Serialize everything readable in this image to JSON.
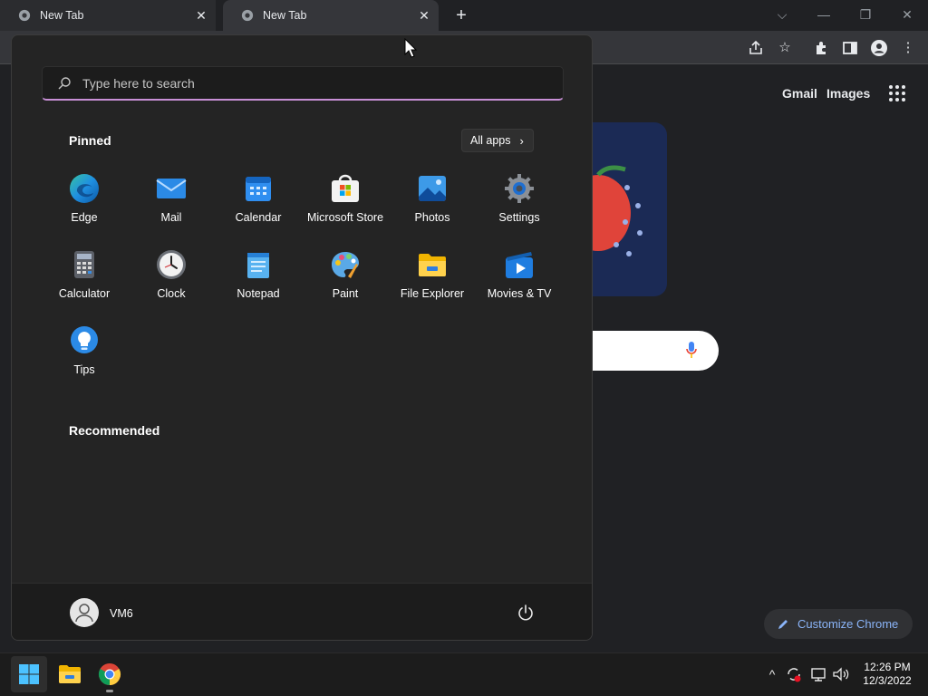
{
  "browser": {
    "tabs": [
      {
        "title": "New Tab",
        "active": false
      },
      {
        "title": "New Tab",
        "active": true
      }
    ],
    "ntp_links": {
      "gmail": "Gmail",
      "images": "Images"
    },
    "customize_label": "Customize Chrome"
  },
  "start_menu": {
    "search_placeholder": "Type here to search",
    "pinned_title": "Pinned",
    "all_apps_label": "All apps",
    "pinned_apps": [
      {
        "label": "Edge",
        "icon": "edge-icon"
      },
      {
        "label": "Mail",
        "icon": "mail-icon"
      },
      {
        "label": "Calendar",
        "icon": "calendar-icon"
      },
      {
        "label": "Microsoft Store",
        "icon": "store-icon"
      },
      {
        "label": "Photos",
        "icon": "photos-icon"
      },
      {
        "label": "Settings",
        "icon": "settings-icon"
      },
      {
        "label": "Calculator",
        "icon": "calculator-icon"
      },
      {
        "label": "Clock",
        "icon": "clock-icon"
      },
      {
        "label": "Notepad",
        "icon": "notepad-icon"
      },
      {
        "label": "Paint",
        "icon": "paint-icon"
      },
      {
        "label": "File Explorer",
        "icon": "folder-icon"
      },
      {
        "label": "Movies & TV",
        "icon": "movies-icon"
      },
      {
        "label": "Tips",
        "icon": "tips-icon"
      }
    ],
    "recommended_title": "Recommended",
    "user_name": "VM6"
  },
  "taskbar": {
    "time": "12:26 PM",
    "date": "12/3/2022"
  },
  "colors": {
    "accent_search_underline": "#c88fd6",
    "link_blue": "#8ab4f8",
    "start_bg": "#242424"
  }
}
